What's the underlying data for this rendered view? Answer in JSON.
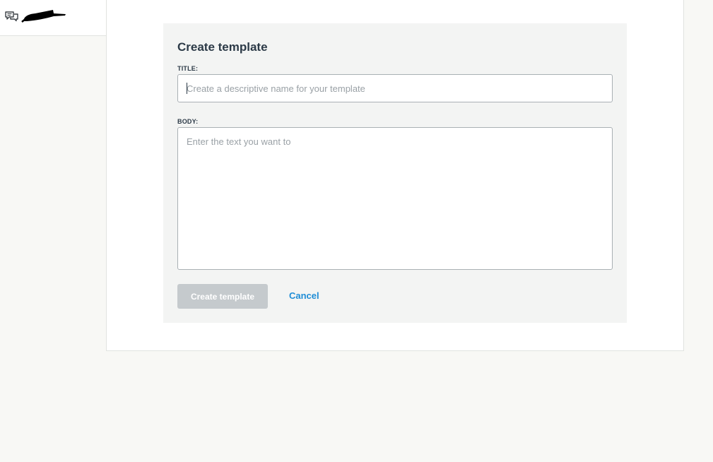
{
  "header": {
    "chat_icon": "chat-bubbles-icon",
    "logo": "redacted-logo"
  },
  "form": {
    "title": "Create template",
    "title_field": {
      "label": "TITLE:",
      "value": "",
      "placeholder": "Create a descriptive name for your template"
    },
    "body_field": {
      "label": "BODY:",
      "value": "",
      "placeholder": "Enter the text you want to"
    },
    "submit_label": "Create template",
    "cancel_label": "Cancel"
  },
  "colors": {
    "page_background": "#f8f8f5",
    "panel_background": "#f3f4f3",
    "heading_text": "#2c3a47",
    "disabled_button": "#c5cacd",
    "link": "#1f8dd6"
  }
}
